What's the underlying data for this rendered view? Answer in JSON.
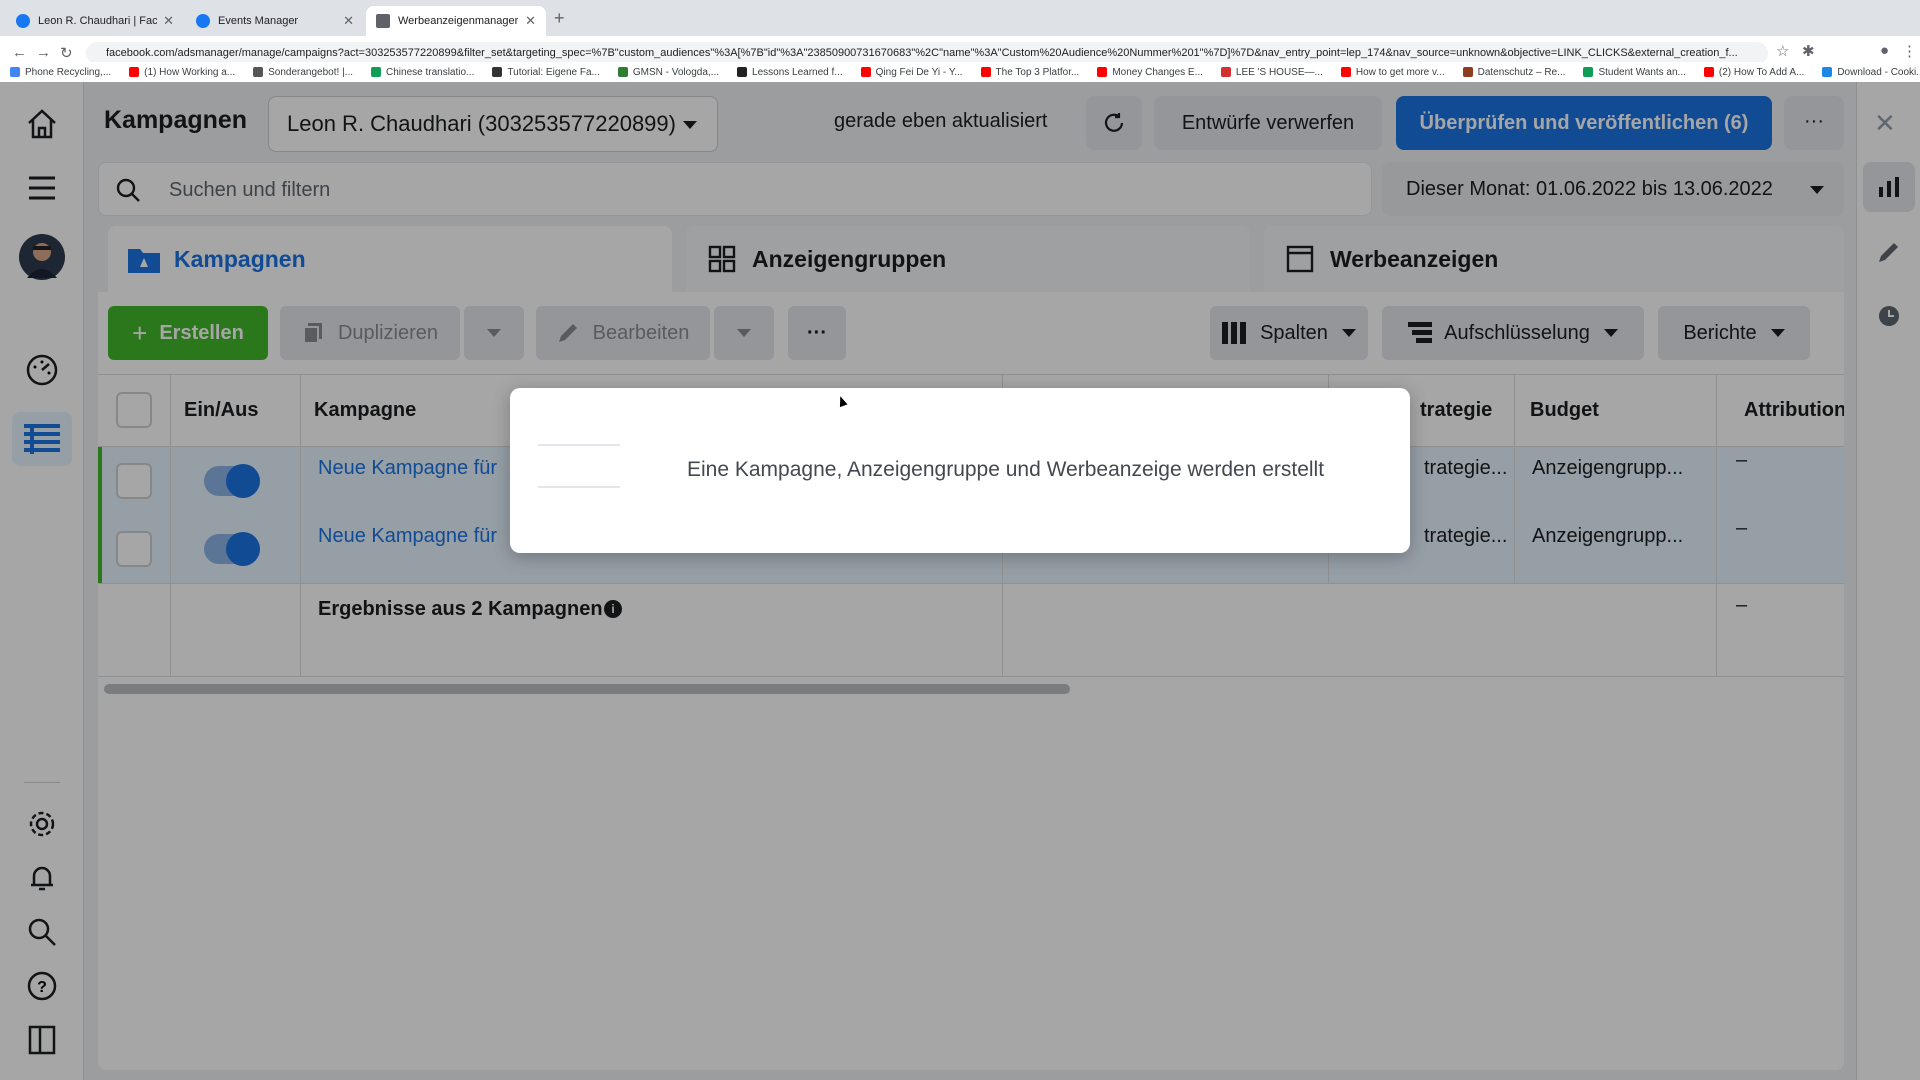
{
  "browser": {
    "tabs": [
      {
        "title": "Leon R. Chaudhari | Facebook"
      },
      {
        "title": "Events Manager"
      },
      {
        "title": "Werbeanzeigenmanager - Wer"
      }
    ],
    "url": "facebook.com/adsmanager/manage/campaigns?act=303253577220899&filter_set&targeting_spec=%7B\"custom_audiences\"%3A[%7B\"id\"%3A\"23850900731670683\"%2C\"name\"%3A\"Custom%20Audience%20Nummer%201\"%7D]%7D&nav_entry_point=lep_174&nav_source=unknown&objective=LINK_CLICKS&external_creation_f...",
    "bookmarks": [
      {
        "label": "Phone Recycling,...",
        "color": "#4285f4"
      },
      {
        "label": "(1) How Working a...",
        "color": "#ff0000"
      },
      {
        "label": "Sonderangebot! |...",
        "color": "#555555"
      },
      {
        "label": "Chinese translatio...",
        "color": "#0f9d58"
      },
      {
        "label": "Tutorial: Eigene Fa...",
        "color": "#333333"
      },
      {
        "label": "GMSN - Vologda,...",
        "color": "#2e7d32"
      },
      {
        "label": "Lessons Learned f...",
        "color": "#222222"
      },
      {
        "label": "Qing Fei De Yi - Y...",
        "color": "#ff0000"
      },
      {
        "label": "The Top 3 Platfor...",
        "color": "#ff0000"
      },
      {
        "label": "Money Changes E...",
        "color": "#ff0000"
      },
      {
        "label": "LEE 'S HOUSE—...",
        "color": "#d32f2f"
      },
      {
        "label": "How to get more v...",
        "color": "#ff0000"
      },
      {
        "label": "Datenschutz – Re...",
        "color": "#8d3c1f"
      },
      {
        "label": "Student Wants an...",
        "color": "#0f9d58"
      },
      {
        "label": "(2) How To Add A...",
        "color": "#ff0000"
      },
      {
        "label": "Download - Cooki...",
        "color": "#1e88e5"
      }
    ]
  },
  "header": {
    "title": "Kampagnen",
    "account": "Leon R. Chaudhari (303253577220899)",
    "updated": "gerade eben aktualisiert",
    "discard": "Entwürfe verwerfen",
    "publish": "Überprüfen und veröffentlichen (6)",
    "more": "···"
  },
  "search": {
    "placeholder": "Suchen und filtern"
  },
  "date_range": "Dieser Monat: 01.06.2022 bis 13.06.2022",
  "tabs": [
    {
      "label": "Kampagnen",
      "active": true
    },
    {
      "label": "Anzeigengruppen",
      "active": false
    },
    {
      "label": "Werbeanzeigen",
      "active": false
    }
  ],
  "toolbar": {
    "create": "Erstellen",
    "duplicate": "Duplizieren",
    "edit": "Bearbeiten",
    "more": "···",
    "columns": "Spalten",
    "breakdown": "Aufschlüsselung",
    "reports": "Berichte"
  },
  "table": {
    "headers": {
      "onoff": "Ein/Aus",
      "campaign": "Kampagne",
      "strategy": "trategie",
      "budget": "Budget",
      "attribution": "Attribution"
    },
    "rows": [
      {
        "name": "Neue Kampagne für ",
        "strategy": "trategie...",
        "budget": "Anzeigengrupp...",
        "attribution": "–",
        "on": true
      },
      {
        "name": "Neue Kampagne für ",
        "strategy": "trategie...",
        "budget": "Anzeigengrupp...",
        "attribution": "–",
        "on": true
      }
    ],
    "summary": "Ergebnisse aus 2 Kampagnen",
    "summary_attribution": "–"
  },
  "modal": {
    "message": "Eine Kampagne, Anzeigengruppe und Werbeanzeige werden erstellt"
  },
  "colors": {
    "accent": "#1b74e4",
    "create": "#42b72a"
  }
}
